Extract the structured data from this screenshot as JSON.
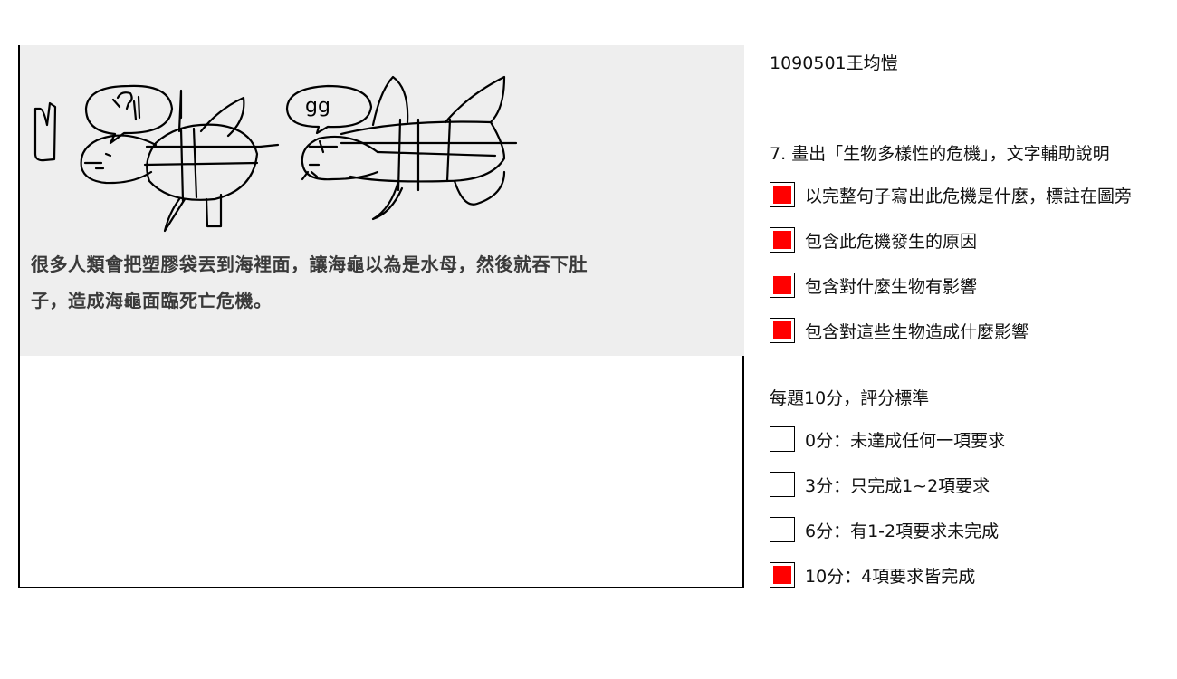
{
  "student": {
    "name": "1090501王均愷"
  },
  "drawing": {
    "speech_bubble_text": "gg",
    "caption_line1": "很多人類會把塑膠袋丟到海裡面，讓海龜以為是水母，然後就吞下肚",
    "caption_line2": "子，造成海龜面臨死亡危機。"
  },
  "question": {
    "title": "7. 畫出「生物多樣性的危機」，文字輔助說明",
    "requirements": [
      {
        "label": "以完整句子寫出此危機是什麼，標註在圖旁",
        "checked": true
      },
      {
        "label": "包含此危機發生的原因",
        "checked": true
      },
      {
        "label": "包含對什麼生物有影響",
        "checked": true
      },
      {
        "label": "包含對這些生物造成什麼影響",
        "checked": true
      }
    ]
  },
  "scoring": {
    "title": "每題10分，評分標準",
    "options": [
      {
        "label": "0分：未達成任何一項要求",
        "checked": false
      },
      {
        "label": "3分：只完成1~2項要求",
        "checked": false
      },
      {
        "label": "6分：有1-2項要求未完成",
        "checked": false
      },
      {
        "label": "10分：4項要求皆完成",
        "checked": true
      }
    ]
  },
  "colors": {
    "checkbox_fill": "#ff0000",
    "drawing_background": "#eeeeee",
    "caption_text": "#3a3a3a"
  }
}
